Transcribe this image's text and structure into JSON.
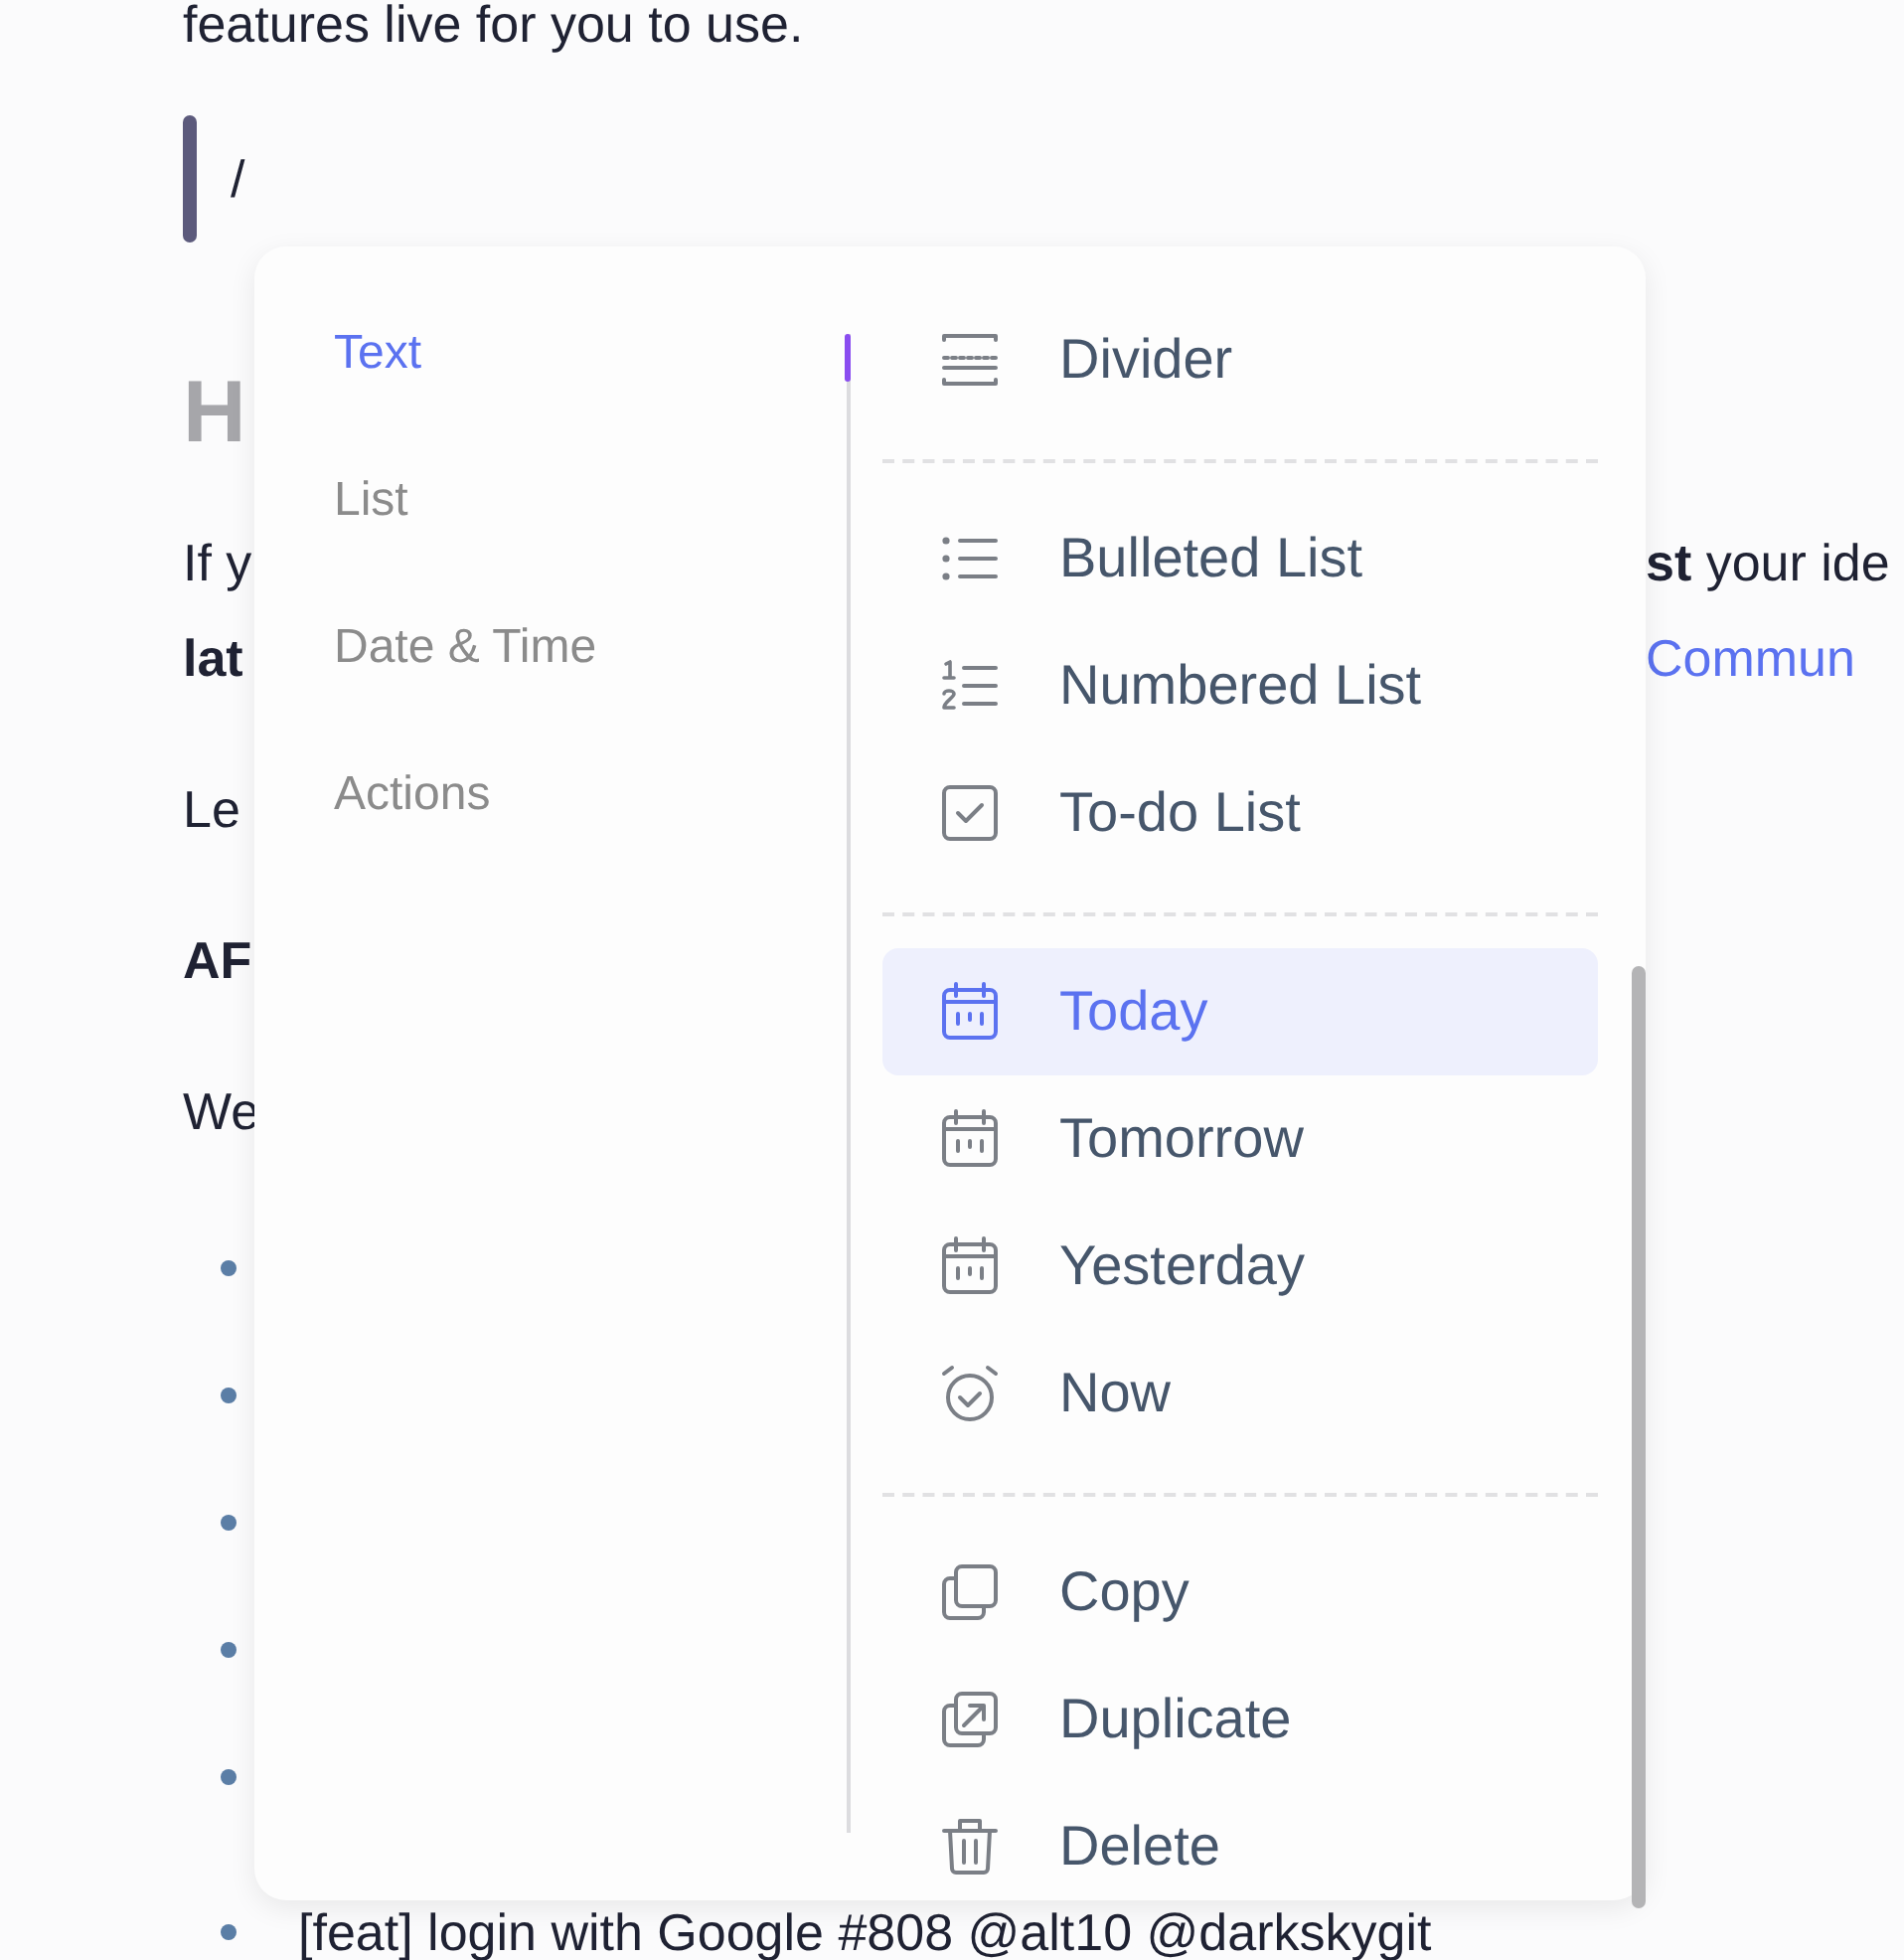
{
  "document": {
    "lines": [
      {
        "kind": "text",
        "text": "features live for you to use."
      },
      {
        "kind": "input",
        "text": "/"
      },
      {
        "kind": "heading",
        "text": "H"
      },
      {
        "kind": "text",
        "text": "If y",
        "continued": "**st** your ide"
      },
      {
        "kind": "bold",
        "text": "lat",
        "link": "Commun"
      },
      {
        "kind": "text",
        "text": "Le"
      },
      {
        "kind": "bold",
        "text": "AF"
      },
      {
        "kind": "text",
        "text": "We"
      },
      {
        "kind": "bullet"
      },
      {
        "kind": "bullet"
      },
      {
        "kind": "bullet"
      },
      {
        "kind": "bullet"
      },
      {
        "kind": "bullet"
      },
      {
        "kind": "bullet",
        "text": "[feat] login with Google #808 @alt10 @darkskygit"
      }
    ]
  },
  "slash_menu": {
    "categories": [
      {
        "label": "Text",
        "selected": true
      },
      {
        "label": "List",
        "selected": false
      },
      {
        "label": "Date & Time",
        "selected": false
      },
      {
        "label": "Actions",
        "selected": false
      }
    ],
    "groups": [
      {
        "items": [
          {
            "kind": "divider",
            "label": "Divider",
            "selected": false
          }
        ]
      },
      {
        "items": [
          {
            "kind": "bulleted",
            "label": "Bulleted List",
            "selected": false
          },
          {
            "kind": "numbered",
            "label": "Numbered List",
            "selected": false
          },
          {
            "kind": "todo",
            "label": "To-do List",
            "selected": false
          }
        ]
      },
      {
        "items": [
          {
            "kind": "calendar",
            "label": "Today",
            "selected": true
          },
          {
            "kind": "calendar",
            "label": "Tomorrow",
            "selected": false
          },
          {
            "kind": "calendar",
            "label": "Yesterday",
            "selected": false
          },
          {
            "kind": "alarm",
            "label": "Now",
            "selected": false
          }
        ]
      },
      {
        "items": [
          {
            "kind": "copy",
            "label": "Copy",
            "selected": false
          },
          {
            "kind": "duplicate",
            "label": "Duplicate",
            "selected": false
          },
          {
            "kind": "trash",
            "label": "Delete",
            "selected": false
          }
        ]
      }
    ]
  }
}
